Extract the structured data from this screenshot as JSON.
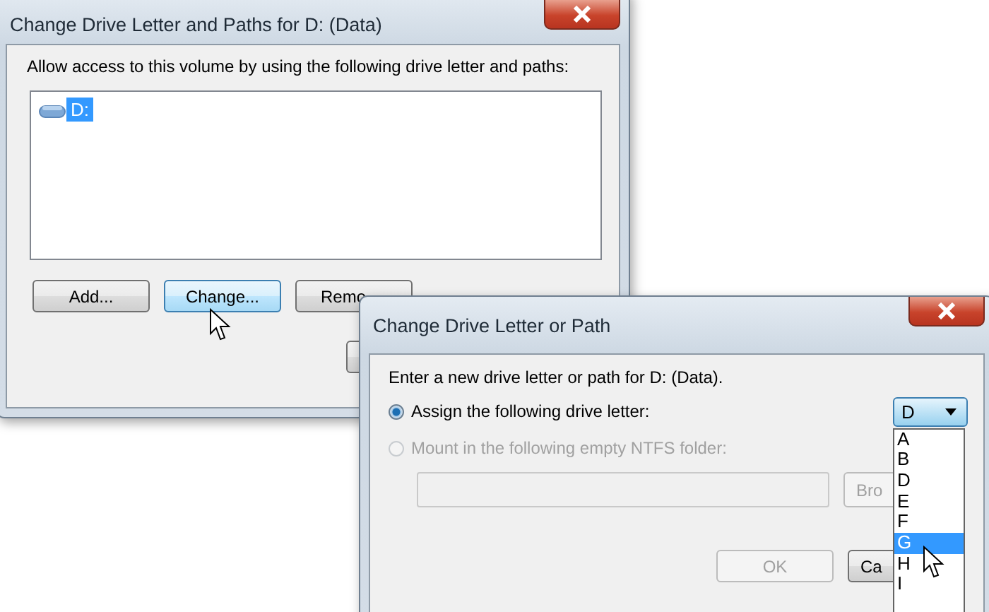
{
  "dialog_paths": {
    "title": "Change Drive Letter and Paths for D: (Data)",
    "prompt": "Allow access to this volume by using the following drive letter and paths:",
    "paths": [
      {
        "label": "D:",
        "selected": true
      }
    ],
    "buttons": [
      {
        "label": "Add...",
        "hovered": false
      },
      {
        "label": "Change...",
        "hovered": true
      },
      {
        "label": "Remo",
        "hovered": false
      }
    ]
  },
  "dialog_change": {
    "title": "Change Drive Letter or Path",
    "prompt": "Enter a new drive letter or path for D: (Data).",
    "options": [
      {
        "label": "Assign the following drive letter:",
        "selected": true,
        "disabled": false
      },
      {
        "label": "Mount in the following empty NTFS folder:",
        "selected": false,
        "disabled": true
      }
    ],
    "folder_field": {
      "disabled": true
    },
    "browse_button": {
      "label": "Bro",
      "disabled": true
    },
    "drive_letter": {
      "value": "D",
      "expanded": true,
      "options": [
        {
          "label": "A",
          "highlighted": false
        },
        {
          "label": "B",
          "highlighted": false
        },
        {
          "label": "D",
          "highlighted": false
        },
        {
          "label": "E",
          "highlighted": false
        },
        {
          "label": "F",
          "highlighted": false
        },
        {
          "label": "G",
          "highlighted": true
        },
        {
          "label": "H",
          "highlighted": false
        },
        {
          "label": "I",
          "highlighted": false
        }
      ]
    },
    "buttons": [
      {
        "label": "OK",
        "disabled": true
      },
      {
        "label": "Ca",
        "disabled": false
      }
    ]
  }
}
